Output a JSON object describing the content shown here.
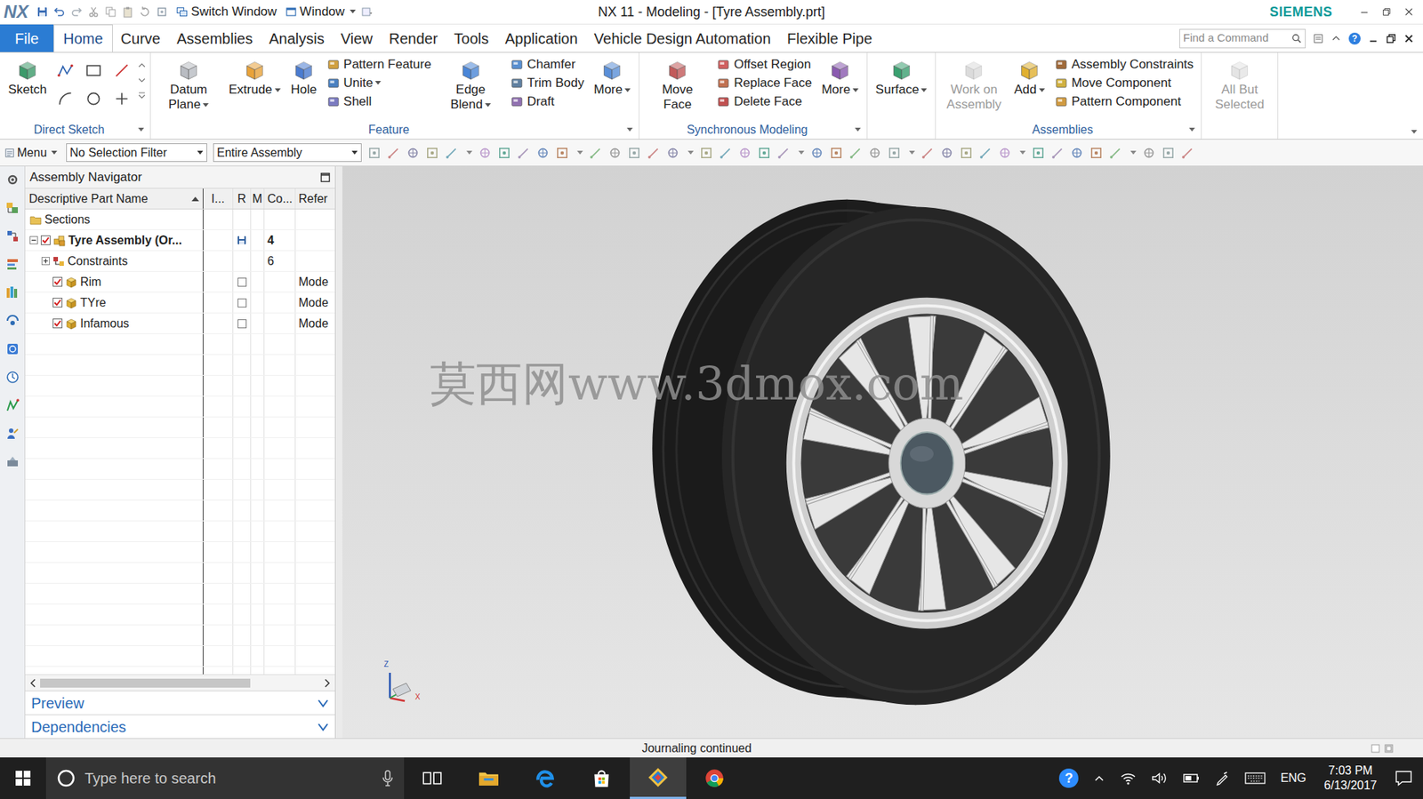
{
  "window": {
    "logo": "NX",
    "quick_access": [
      "Switch Window",
      "Window"
    ],
    "title": "NX 11 - Modeling - [Tyre Assembly.prt]",
    "brand": "SIEMENS"
  },
  "file_menu": {
    "label": "File"
  },
  "menu_tabs": [
    {
      "label": "Home",
      "selected": true
    },
    {
      "label": "Curve",
      "selected": false
    },
    {
      "label": "Assemblies",
      "selected": false
    },
    {
      "label": "Analysis",
      "selected": false
    },
    {
      "label": "View",
      "selected": false
    },
    {
      "label": "Render",
      "selected": false
    },
    {
      "label": "Tools",
      "selected": false
    },
    {
      "label": "Application",
      "selected": false
    },
    {
      "label": "Vehicle Design Automation",
      "selected": false
    },
    {
      "label": "Flexible Pipe",
      "selected": false
    }
  ],
  "command_search": {
    "placeholder": "Find a Command"
  },
  "help_glyph": "?",
  "ribbon": {
    "groups": [
      {
        "label": "Direct Sketch",
        "items": [
          {
            "kind": "large",
            "label": "Sketch",
            "dropdown": false,
            "disabled": false
          },
          {
            "kind": "sketch-tools"
          }
        ]
      },
      {
        "label": "Feature",
        "items": [
          {
            "kind": "large",
            "label": "Datum Plane",
            "dropdown": true,
            "disabled": false
          },
          {
            "kind": "large",
            "label": "Extrude",
            "dropdown": true,
            "disabled": false
          },
          {
            "kind": "large",
            "label": "Hole",
            "dropdown": false,
            "disabled": false
          },
          {
            "kind": "column",
            "items": [
              {
                "label": "Pattern Feature",
                "dropdown": false
              },
              {
                "label": "Unite",
                "dropdown": true
              },
              {
                "label": "Shell",
                "dropdown": false
              }
            ]
          },
          {
            "kind": "large",
            "label": "Edge Blend",
            "dropdown": true,
            "disabled": false
          },
          {
            "kind": "column",
            "items": [
              {
                "label": "Chamfer",
                "dropdown": false
              },
              {
                "label": "Trim Body",
                "dropdown": false
              },
              {
                "label": "Draft",
                "dropdown": false
              }
            ]
          },
          {
            "kind": "large",
            "label": "More",
            "dropdown": true,
            "disabled": false
          }
        ]
      },
      {
        "label": "Synchronous Modeling",
        "items": [
          {
            "kind": "large",
            "label": "Move Face",
            "dropdown": false,
            "disabled": false
          },
          {
            "kind": "column",
            "items": [
              {
                "label": "Offset Region",
                "dropdown": false
              },
              {
                "label": "Replace Face",
                "dropdown": false
              },
              {
                "label": "Delete Face",
                "dropdown": false
              }
            ]
          },
          {
            "kind": "large",
            "label": "More",
            "dropdown": true,
            "disabled": false
          }
        ]
      },
      {
        "items": [
          {
            "kind": "large",
            "label": "Surface",
            "dropdown": true,
            "disabled": false
          }
        ]
      },
      {
        "label": "Assemblies",
        "items": [
          {
            "kind": "large",
            "label": "Work on Assembly",
            "dropdown": false,
            "disabled": true
          },
          {
            "kind": "large",
            "label": "Add",
            "dropdown": true,
            "disabled": false
          },
          {
            "kind": "column",
            "items": [
              {
                "label": "Assembly Constraints",
                "dropdown": false
              },
              {
                "label": "Move Component",
                "dropdown": false
              },
              {
                "label": "Pattern Component",
                "dropdown": false
              }
            ]
          }
        ]
      },
      {
        "items": [
          {
            "kind": "large",
            "label": "All But Selected",
            "dropdown": false,
            "disabled": true
          }
        ]
      }
    ]
  },
  "toolbar": {
    "menu": "Menu",
    "filters": [
      "No Selection Filter",
      "Entire Assembly"
    ]
  },
  "navigator": {
    "title": "Assembly Navigator",
    "columns": [
      "Descriptive Part Name",
      "I...",
      "R",
      "M",
      "Co...",
      "Refer"
    ],
    "sort_ascending": true,
    "rows": [
      {
        "name": "Sections",
        "kind": "folder",
        "depth": 0
      },
      {
        "name": "Tyre Assembly (Or...",
        "kind": "assembly",
        "depth": 0,
        "expanded": true,
        "checked": true,
        "modified": true,
        "count": "4"
      },
      {
        "name": "Constraints",
        "kind": "constraints",
        "depth": 1,
        "expanded": false,
        "count": "6"
      },
      {
        "name": "Rim",
        "kind": "part",
        "depth": 1,
        "checked": true,
        "read_only": false,
        "reference": "Mode"
      },
      {
        "name": "TYre",
        "kind": "part",
        "depth": 1,
        "checked": true,
        "read_only": false,
        "reference": "Mode"
      },
      {
        "name": "Infamous",
        "kind": "part",
        "depth": 1,
        "checked": true,
        "read_only": false,
        "reference": "Mode"
      }
    ],
    "panels": [
      {
        "label": "Preview",
        "expanded": false
      },
      {
        "label": "Dependencies",
        "expanded": false
      }
    ]
  },
  "viewport": {
    "watermark": "莫西网www.3dmox.com",
    "triad": [
      "Z",
      "X"
    ]
  },
  "status_bar": {
    "message": "Journaling continued"
  },
  "taskbar": {
    "search_placeholder": "Type here to search",
    "apps": [
      {
        "kind": "task-view",
        "active": false
      },
      {
        "kind": "file-explorer",
        "active": false
      },
      {
        "kind": "edge",
        "active": false
      },
      {
        "kind": "store",
        "active": false
      },
      {
        "kind": "nx",
        "active": true
      },
      {
        "kind": "chrome",
        "active": false
      }
    ],
    "language": "ENG",
    "time": "7:03 PM",
    "date": "6/13/2017"
  }
}
